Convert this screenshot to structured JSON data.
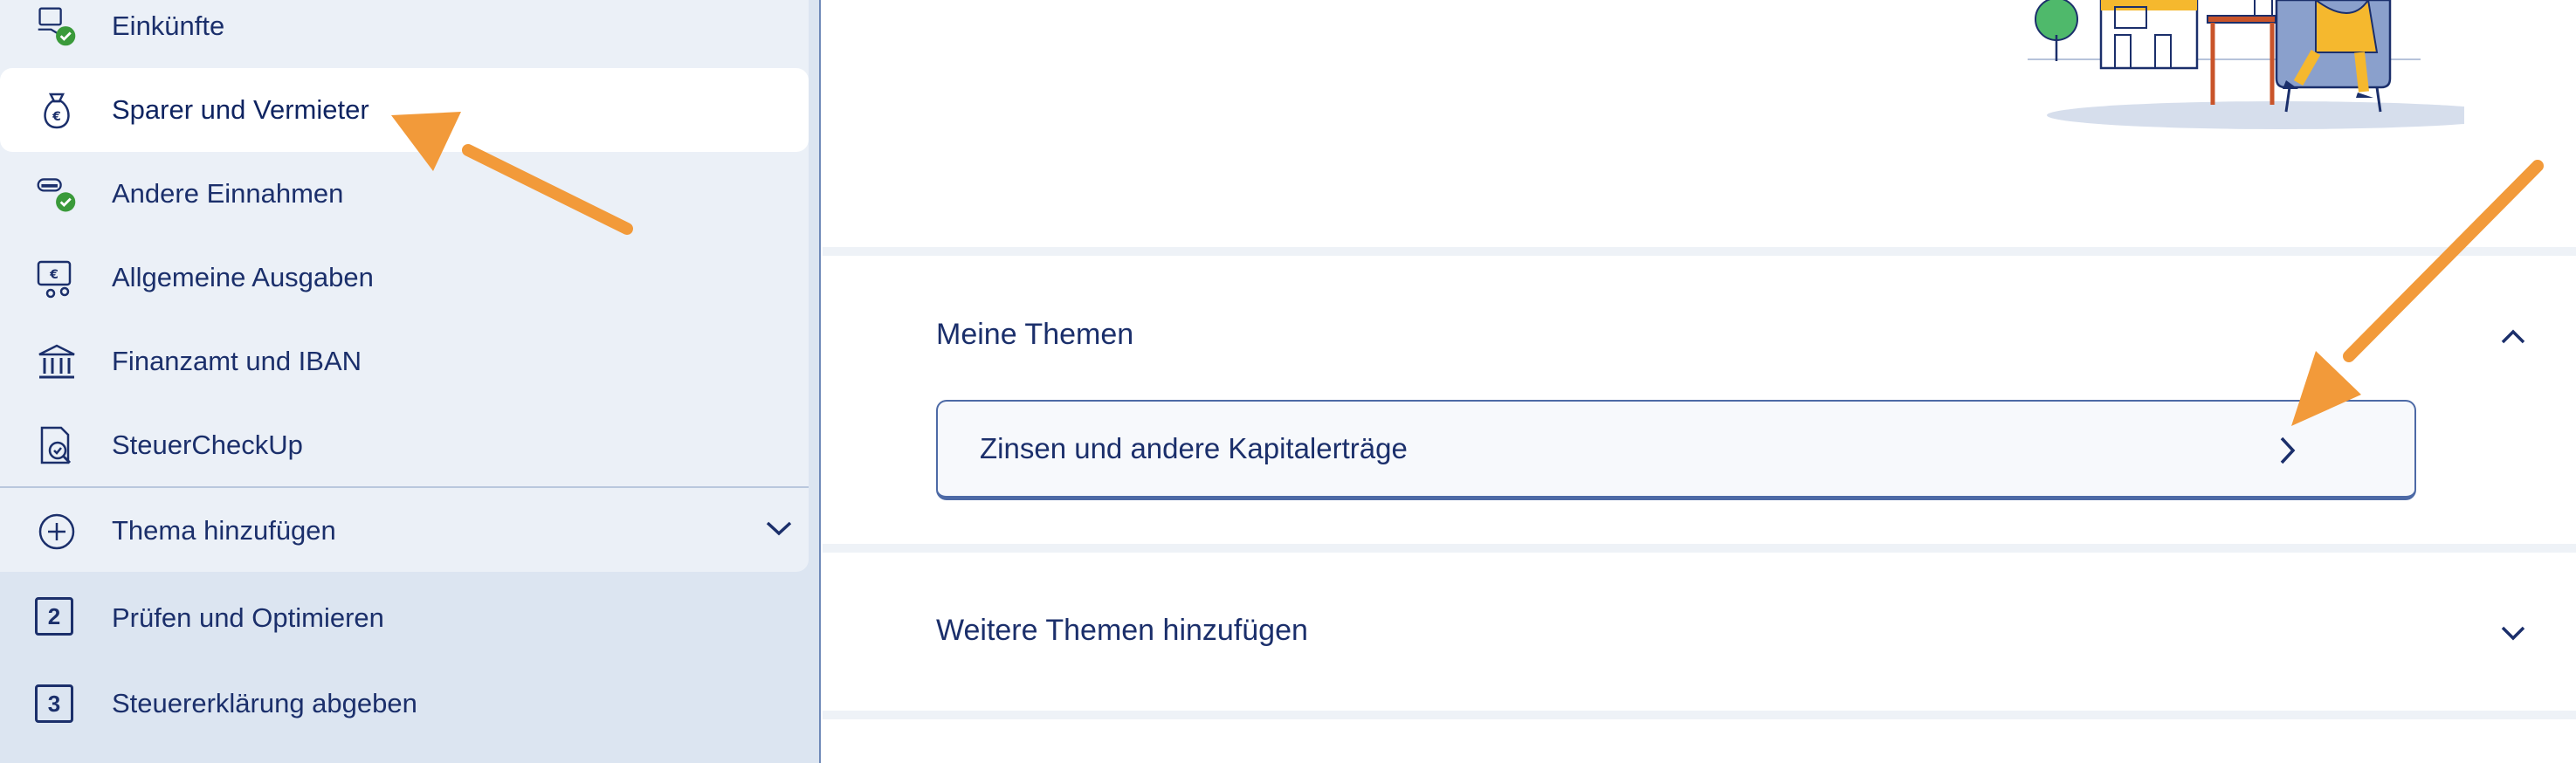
{
  "sidebar": {
    "items": [
      {
        "label": "Einkünfte",
        "icon": "income-check-icon",
        "completed": true,
        "active": false
      },
      {
        "label": "Sparer und Vermieter",
        "icon": "money-bag-euro-icon",
        "completed": false,
        "active": true
      },
      {
        "label": "Andere Einnahmen",
        "icon": "coins-check-icon",
        "completed": true,
        "active": false
      },
      {
        "label": "Allgemeine Ausgaben",
        "icon": "banknote-euro-icon",
        "completed": false,
        "active": false
      },
      {
        "label": "Finanzamt und IBAN",
        "icon": "bank-building-icon",
        "completed": false,
        "active": false
      },
      {
        "label": "SteuerCheckUp",
        "icon": "document-check-icon",
        "completed": false,
        "active": false
      }
    ],
    "add_topic": {
      "label": "Thema hinzufügen",
      "icon": "plus-circle-icon",
      "toggle_icon": "chevron-down-icon"
    },
    "steps": [
      {
        "number": "2",
        "label": "Prüfen und Optimieren"
      },
      {
        "number": "3",
        "label": "Steuererklärung abgeben"
      }
    ]
  },
  "main": {
    "my_topics": {
      "title": "Meine Themen",
      "toggle_icon": "chevron-up-icon",
      "cards": [
        {
          "label": "Zinsen und andere Kapitalerträge",
          "icon": "chevron-right-icon"
        }
      ]
    },
    "more_topics": {
      "title": "Weitere Themen hinzufügen",
      "toggle_icon": "chevron-down-icon"
    }
  },
  "colors": {
    "primary_text": "#1b2f6b",
    "sidebar_bg": "#dce5f1",
    "sidebar_panel_bg": "#ebf0f7",
    "check_green": "#3a9a3a",
    "annotation_orange": "#f29a3a",
    "illustration_yellow": "#f5b82e"
  }
}
